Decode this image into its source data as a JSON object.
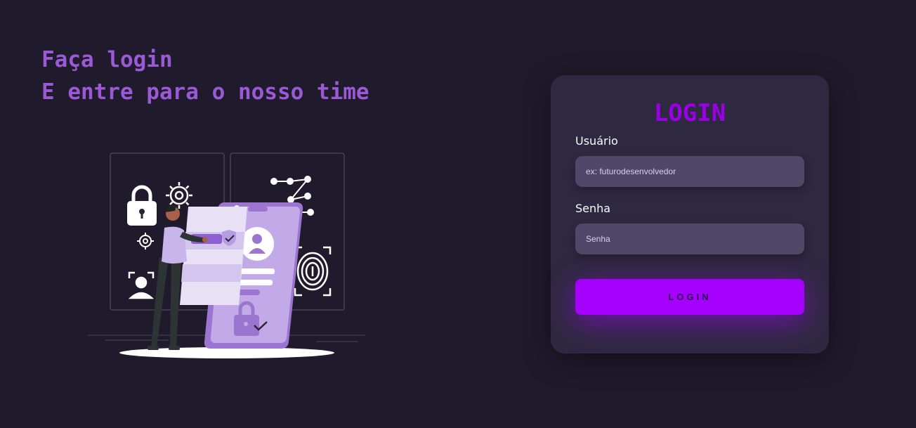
{
  "headline": {
    "line1": "Faça login",
    "line2": "E entre para o nosso time"
  },
  "illustration": {
    "name": "security-login-illustration"
  },
  "login_card": {
    "title": "LOGIN",
    "username": {
      "label": "Usuário",
      "placeholder": "ex: futurodesenvolvedor",
      "value": ""
    },
    "password": {
      "label": "Senha",
      "placeholder": "Senha",
      "value": ""
    },
    "submit_label": "LOGIN"
  },
  "colors": {
    "background": "#201b2c",
    "card": "#2f2841",
    "input": "#514869",
    "accent": "#a600ff",
    "headline": "#9b59d6"
  }
}
